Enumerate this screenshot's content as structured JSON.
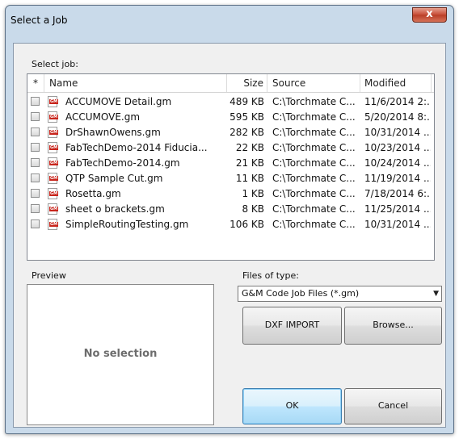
{
  "window": {
    "title": "Select a Job",
    "close_glyph": "x"
  },
  "select_job_label": "Select job:",
  "table": {
    "columns": [
      "*",
      "Name",
      "Size",
      "Source",
      "Modified"
    ],
    "rows": [
      {
        "name": "ACCUMOVE Detail.gm",
        "size": "489 KB",
        "source": "C:\\Torchmate C...",
        "modified": "11/6/2014 2:..."
      },
      {
        "name": "ACCUMOVE.gm",
        "size": "595 KB",
        "source": "C:\\Torchmate C...",
        "modified": "5/20/2014 8:..."
      },
      {
        "name": "DrShawnOwens.gm",
        "size": "282 KB",
        "source": "C:\\Torchmate C...",
        "modified": "10/31/2014 ..."
      },
      {
        "name": "FabTechDemo-2014 Fiducia...",
        "size": "22 KB",
        "source": "C:\\Torchmate C...",
        "modified": "10/23/2014 ..."
      },
      {
        "name": "FabTechDemo-2014.gm",
        "size": "21 KB",
        "source": "C:\\Torchmate C...",
        "modified": "10/24/2014 ..."
      },
      {
        "name": "QTP Sample Cut.gm",
        "size": "11 KB",
        "source": "C:\\Torchmate C...",
        "modified": "11/19/2014 ..."
      },
      {
        "name": "Rosetta.gm",
        "size": "1 KB",
        "source": "C:\\Torchmate C...",
        "modified": "7/18/2014 6:..."
      },
      {
        "name": "sheet o brackets.gm",
        "size": "8 KB",
        "source": "C:\\Torchmate C...",
        "modified": "11/25/2014 ..."
      },
      {
        "name": "SimpleRoutingTesting.gm",
        "size": "106 KB",
        "source": "C:\\Torchmate C...",
        "modified": "10/31/2014 ..."
      }
    ],
    "file_icon": "gm-file-icon",
    "file_icon_text": "GM"
  },
  "preview": {
    "label": "Preview",
    "empty_text": "No selection"
  },
  "file_type": {
    "label": "Files of type:",
    "selected": "G&M Code Job Files (*.gm)"
  },
  "buttons": {
    "dxf_import": "DXF IMPORT",
    "browse": "Browse...",
    "ok": "OK",
    "cancel": "Cancel"
  },
  "colors": {
    "title_bar": "#c9daea",
    "close_button": "#c64a34",
    "default_button": "#bee6fd"
  }
}
